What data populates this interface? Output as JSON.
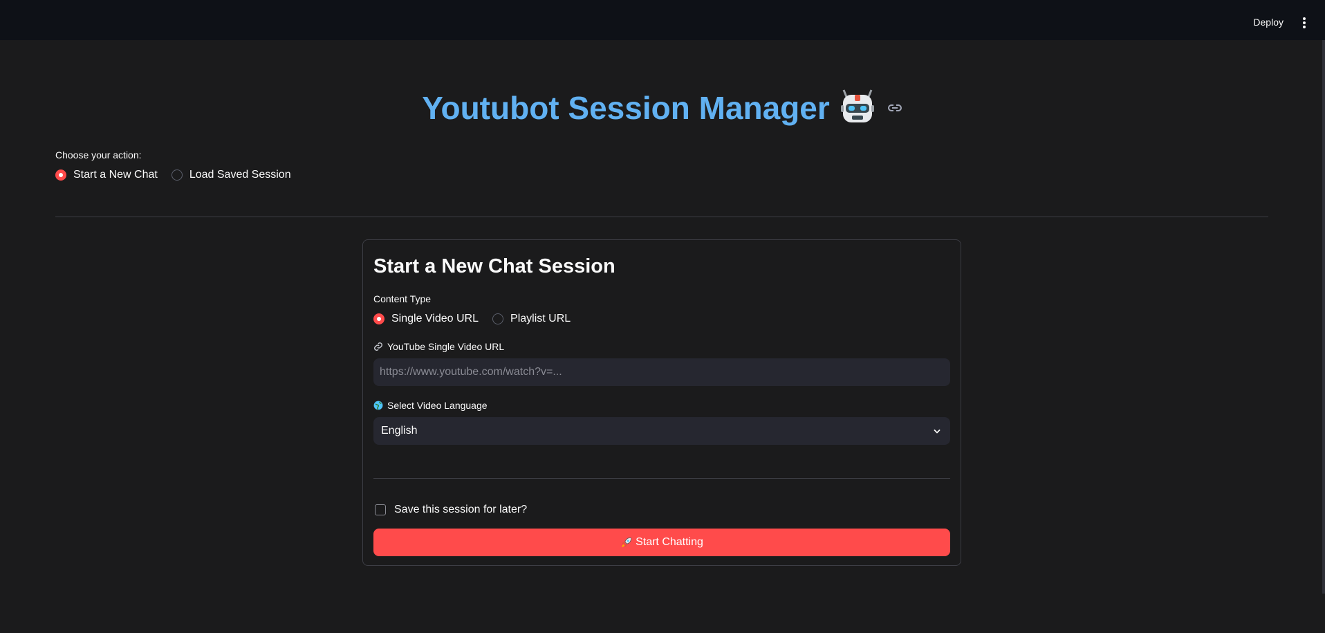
{
  "header": {
    "deploy_label": "Deploy",
    "menu_icon": "kebab-menu-icon"
  },
  "page": {
    "title": "Youtubot Session Manager",
    "title_color": "#61b1f2",
    "title_emoji": "robot-icon"
  },
  "action": {
    "label": "Choose your action:",
    "options": [
      "Start a New Chat",
      "Load Saved Session"
    ],
    "selected": "Start a New Chat"
  },
  "card": {
    "title": "Start a New Chat Session",
    "content_type": {
      "label": "Content Type",
      "options": [
        "Single Video URL",
        "Playlist URL"
      ],
      "selected": "Single Video URL"
    },
    "url_field": {
      "label": "YouTube Single Video URL",
      "placeholder": "https://www.youtube.com/watch?v=...",
      "value": ""
    },
    "language": {
      "label": "Select Video Language",
      "selected": "English"
    },
    "save_checkbox": {
      "label": "Save this session for later?",
      "checked": false
    },
    "start_button": {
      "label": "Start Chatting",
      "icon": "rocket-icon",
      "color": "#ff4b4b"
    }
  }
}
